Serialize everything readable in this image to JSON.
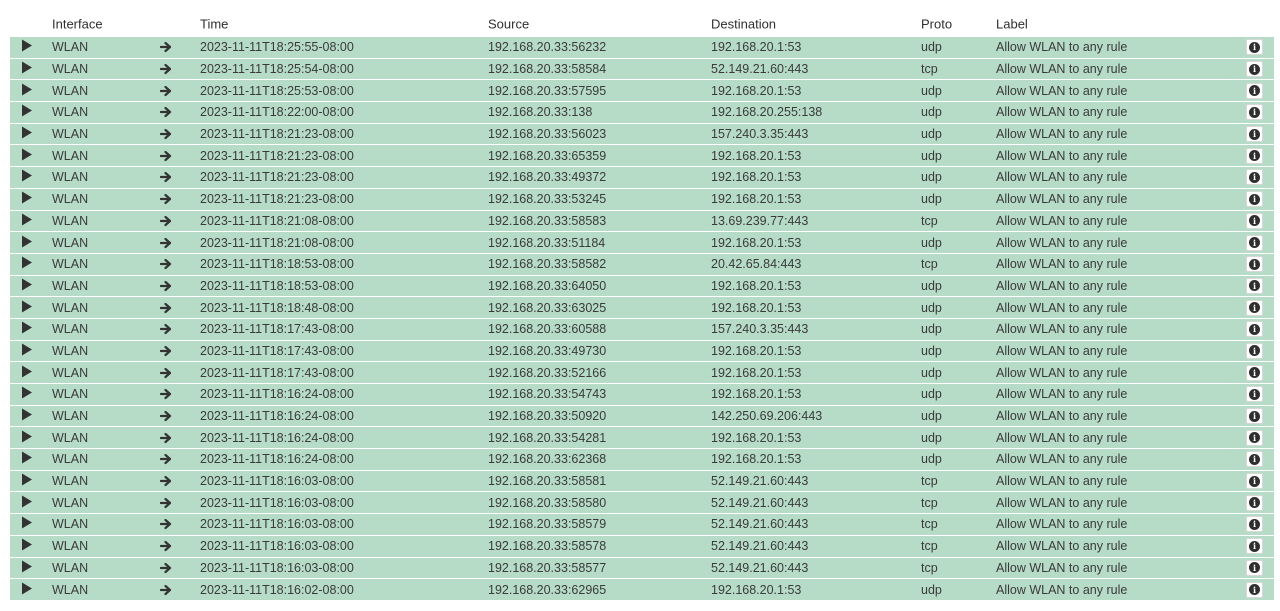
{
  "columns": {
    "interface": "Interface",
    "time": "Time",
    "source": "Source",
    "destination": "Destination",
    "proto": "Proto",
    "label": "Label"
  },
  "icons": {
    "expand": "play-icon",
    "direction": "arrow-right-icon",
    "info": "info-icon"
  },
  "colors": {
    "row_pass": "#b6dcc8"
  },
  "rows": [
    {
      "interface": "WLAN",
      "time": "2023-11-11T18:25:55-08:00",
      "source": "192.168.20.33:56232",
      "destination": "192.168.20.1:53",
      "proto": "udp",
      "label": "Allow WLAN to any rule"
    },
    {
      "interface": "WLAN",
      "time": "2023-11-11T18:25:54-08:00",
      "source": "192.168.20.33:58584",
      "destination": "52.149.21.60:443",
      "proto": "tcp",
      "label": "Allow WLAN to any rule"
    },
    {
      "interface": "WLAN",
      "time": "2023-11-11T18:25:53-08:00",
      "source": "192.168.20.33:57595",
      "destination": "192.168.20.1:53",
      "proto": "udp",
      "label": "Allow WLAN to any rule"
    },
    {
      "interface": "WLAN",
      "time": "2023-11-11T18:22:00-08:00",
      "source": "192.168.20.33:138",
      "destination": "192.168.20.255:138",
      "proto": "udp",
      "label": "Allow WLAN to any rule"
    },
    {
      "interface": "WLAN",
      "time": "2023-11-11T18:21:23-08:00",
      "source": "192.168.20.33:56023",
      "destination": "157.240.3.35:443",
      "proto": "udp",
      "label": "Allow WLAN to any rule"
    },
    {
      "interface": "WLAN",
      "time": "2023-11-11T18:21:23-08:00",
      "source": "192.168.20.33:65359",
      "destination": "192.168.20.1:53",
      "proto": "udp",
      "label": "Allow WLAN to any rule"
    },
    {
      "interface": "WLAN",
      "time": "2023-11-11T18:21:23-08:00",
      "source": "192.168.20.33:49372",
      "destination": "192.168.20.1:53",
      "proto": "udp",
      "label": "Allow WLAN to any rule"
    },
    {
      "interface": "WLAN",
      "time": "2023-11-11T18:21:23-08:00",
      "source": "192.168.20.33:53245",
      "destination": "192.168.20.1:53",
      "proto": "udp",
      "label": "Allow WLAN to any rule"
    },
    {
      "interface": "WLAN",
      "time": "2023-11-11T18:21:08-08:00",
      "source": "192.168.20.33:58583",
      "destination": "13.69.239.77:443",
      "proto": "tcp",
      "label": "Allow WLAN to any rule"
    },
    {
      "interface": "WLAN",
      "time": "2023-11-11T18:21:08-08:00",
      "source": "192.168.20.33:51184",
      "destination": "192.168.20.1:53",
      "proto": "udp",
      "label": "Allow WLAN to any rule"
    },
    {
      "interface": "WLAN",
      "time": "2023-11-11T18:18:53-08:00",
      "source": "192.168.20.33:58582",
      "destination": "20.42.65.84:443",
      "proto": "tcp",
      "label": "Allow WLAN to any rule"
    },
    {
      "interface": "WLAN",
      "time": "2023-11-11T18:18:53-08:00",
      "source": "192.168.20.33:64050",
      "destination": "192.168.20.1:53",
      "proto": "udp",
      "label": "Allow WLAN to any rule"
    },
    {
      "interface": "WLAN",
      "time": "2023-11-11T18:18:48-08:00",
      "source": "192.168.20.33:63025",
      "destination": "192.168.20.1:53",
      "proto": "udp",
      "label": "Allow WLAN to any rule"
    },
    {
      "interface": "WLAN",
      "time": "2023-11-11T18:17:43-08:00",
      "source": "192.168.20.33:60588",
      "destination": "157.240.3.35:443",
      "proto": "udp",
      "label": "Allow WLAN to any rule"
    },
    {
      "interface": "WLAN",
      "time": "2023-11-11T18:17:43-08:00",
      "source": "192.168.20.33:49730",
      "destination": "192.168.20.1:53",
      "proto": "udp",
      "label": "Allow WLAN to any rule"
    },
    {
      "interface": "WLAN",
      "time": "2023-11-11T18:17:43-08:00",
      "source": "192.168.20.33:52166",
      "destination": "192.168.20.1:53",
      "proto": "udp",
      "label": "Allow WLAN to any rule"
    },
    {
      "interface": "WLAN",
      "time": "2023-11-11T18:16:24-08:00",
      "source": "192.168.20.33:54743",
      "destination": "192.168.20.1:53",
      "proto": "udp",
      "label": "Allow WLAN to any rule"
    },
    {
      "interface": "WLAN",
      "time": "2023-11-11T18:16:24-08:00",
      "source": "192.168.20.33:50920",
      "destination": "142.250.69.206:443",
      "proto": "udp",
      "label": "Allow WLAN to any rule"
    },
    {
      "interface": "WLAN",
      "time": "2023-11-11T18:16:24-08:00",
      "source": "192.168.20.33:54281",
      "destination": "192.168.20.1:53",
      "proto": "udp",
      "label": "Allow WLAN to any rule"
    },
    {
      "interface": "WLAN",
      "time": "2023-11-11T18:16:24-08:00",
      "source": "192.168.20.33:62368",
      "destination": "192.168.20.1:53",
      "proto": "udp",
      "label": "Allow WLAN to any rule"
    },
    {
      "interface": "WLAN",
      "time": "2023-11-11T18:16:03-08:00",
      "source": "192.168.20.33:58581",
      "destination": "52.149.21.60:443",
      "proto": "tcp",
      "label": "Allow WLAN to any rule"
    },
    {
      "interface": "WLAN",
      "time": "2023-11-11T18:16:03-08:00",
      "source": "192.168.20.33:58580",
      "destination": "52.149.21.60:443",
      "proto": "tcp",
      "label": "Allow WLAN to any rule"
    },
    {
      "interface": "WLAN",
      "time": "2023-11-11T18:16:03-08:00",
      "source": "192.168.20.33:58579",
      "destination": "52.149.21.60:443",
      "proto": "tcp",
      "label": "Allow WLAN to any rule"
    },
    {
      "interface": "WLAN",
      "time": "2023-11-11T18:16:03-08:00",
      "source": "192.168.20.33:58578",
      "destination": "52.149.21.60:443",
      "proto": "tcp",
      "label": "Allow WLAN to any rule"
    },
    {
      "interface": "WLAN",
      "time": "2023-11-11T18:16:03-08:00",
      "source": "192.168.20.33:58577",
      "destination": "52.149.21.60:443",
      "proto": "tcp",
      "label": "Allow WLAN to any rule"
    },
    {
      "interface": "WLAN",
      "time": "2023-11-11T18:16:02-08:00",
      "source": "192.168.20.33:62965",
      "destination": "192.168.20.1:53",
      "proto": "udp",
      "label": "Allow WLAN to any rule"
    }
  ]
}
